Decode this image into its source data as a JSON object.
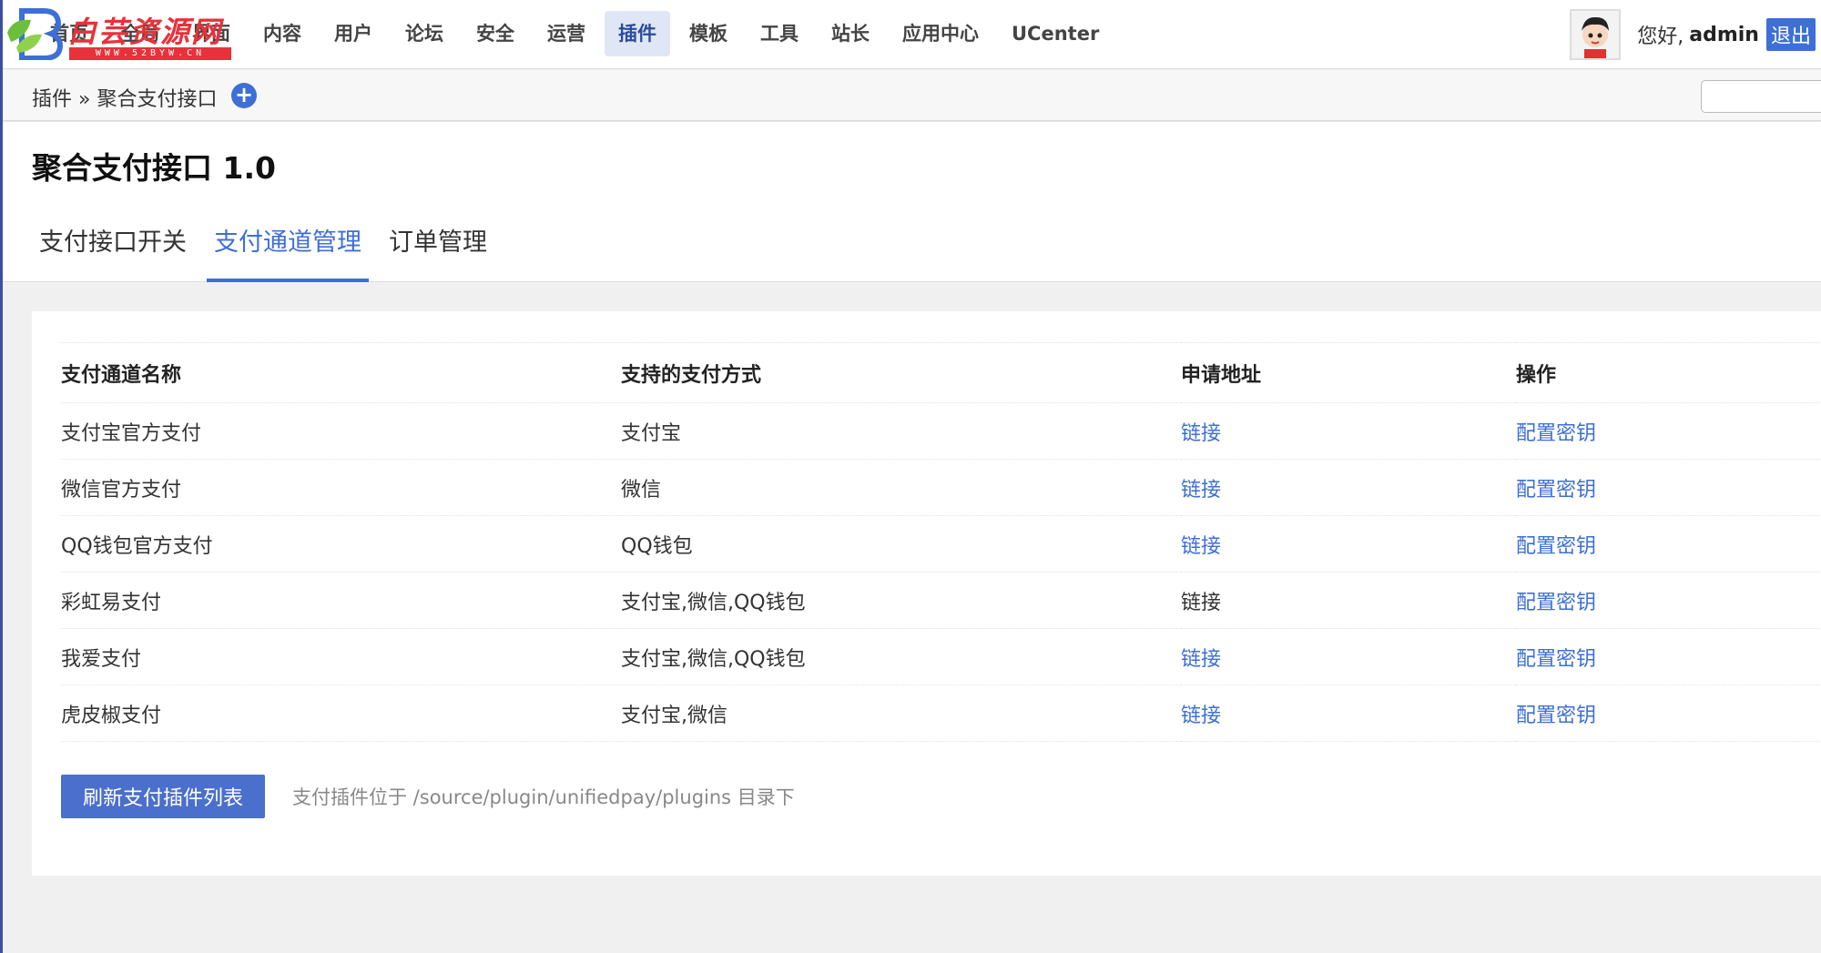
{
  "logo": {
    "name": "白芸资源网",
    "url": "WWW.52BYW.CN"
  },
  "nav": {
    "items": [
      "首页",
      "全局",
      "界面",
      "内容",
      "用户",
      "论坛",
      "安全",
      "运营",
      "插件",
      "模板",
      "工具",
      "站长",
      "应用中心",
      "UCenter"
    ],
    "active": "插件"
  },
  "user": {
    "greeting": "您好,",
    "name": "admin",
    "logout": "退出"
  },
  "breadcrumb": {
    "text": "插件 » 聚合支付接口",
    "add_icon": "plus-circle-icon"
  },
  "page": {
    "title": "聚合支付接口 1.0"
  },
  "tabs": [
    {
      "label": "支付接口开关",
      "active": false
    },
    {
      "label": "支付通道管理",
      "active": true
    },
    {
      "label": "订单管理",
      "active": false
    }
  ],
  "table": {
    "headers": [
      "支付通道名称",
      "支持的支付方式",
      "申请地址",
      "操作"
    ],
    "rows": [
      {
        "name": "支付宝官方支付",
        "methods": "支付宝",
        "apply": "链接",
        "apply_is_link": true,
        "action": "配置密钥"
      },
      {
        "name": "微信官方支付",
        "methods": "微信",
        "apply": "链接",
        "apply_is_link": true,
        "action": "配置密钥"
      },
      {
        "name": "QQ钱包官方支付",
        "methods": "QQ钱包",
        "apply": "链接",
        "apply_is_link": true,
        "action": "配置密钥"
      },
      {
        "name": "彩虹易支付",
        "methods": "支付宝,微信,QQ钱包",
        "apply": "链接",
        "apply_is_link": false,
        "action": "配置密钥"
      },
      {
        "name": "我爱支付",
        "methods": "支付宝,微信,QQ钱包",
        "apply": "链接",
        "apply_is_link": true,
        "action": "配置密钥"
      },
      {
        "name": "虎皮椒支付",
        "methods": "支付宝,微信",
        "apply": "链接",
        "apply_is_link": true,
        "action": "配置密钥"
      }
    ]
  },
  "footer": {
    "refresh_label": "刷新支付插件列表",
    "hint": "支付插件位于 /source/plugin/unifiedpay/plugins 目录下"
  },
  "colors": {
    "accent": "#3d6fd6",
    "logo_red": "#e8313a",
    "nav_active_bg": "#dfe7f6"
  }
}
